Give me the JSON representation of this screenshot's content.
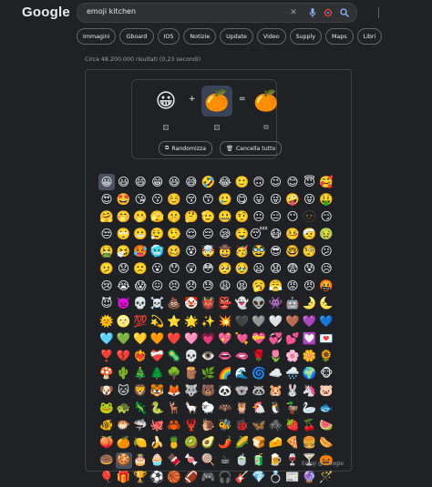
{
  "header": {
    "logo": "Google",
    "query": "emoji kitchen"
  },
  "icons": {
    "clear": "close-icon",
    "mic": "mic-icon",
    "lens": "lens-icon",
    "search": "search-icon"
  },
  "chips": [
    "Immagini",
    "Gboard",
    "IOS",
    "Notizie",
    "Update",
    "Video",
    "Supply",
    "Maps",
    "Libri"
  ],
  "stats": "Circa 48.200.000 risultati (0,23 secondi)",
  "kitchen": {
    "left_emoji": "😀",
    "right_emoji": "🍊",
    "result_emoji": "🍊",
    "plus": "+",
    "equals": "=",
    "shuffle_label": "Randomizza",
    "clear_label": "Cancella tutto",
    "credit": "Emoji @ Google"
  },
  "emoji_grid": [
    "😀",
    "😃",
    "😄",
    "😁",
    "😆",
    "😅",
    "🤣",
    "😂",
    "🙂",
    "🙃",
    "😉",
    "😊",
    "😇",
    "🥰",
    "😍",
    "🤩",
    "😘",
    "😗",
    "☺️",
    "😚",
    "😙",
    "🥲",
    "😋",
    "😛",
    "😜",
    "🤪",
    "😝",
    "🤑",
    "🤗",
    "🤭",
    "🫢",
    "🫣",
    "🤫",
    "🤔",
    "🫡",
    "🤐",
    "🤨",
    "😐",
    "😑",
    "😶",
    "🫥",
    "😏",
    "😒",
    "🙄",
    "😬",
    "😮‍💨",
    "🤥",
    "😌",
    "😔",
    "😪",
    "🤤",
    "😴",
    "😷",
    "🤒",
    "🤕",
    "🤢",
    "🤮",
    "🤧",
    "🥵",
    "🥶",
    "🥴",
    "😵",
    "🤯",
    "🤠",
    "🥳",
    "🥸",
    "😎",
    "🤓",
    "🧐",
    "😕",
    "🫤",
    "😟",
    "🙁",
    "😮",
    "😯",
    "😲",
    "😳",
    "🥺",
    "🥹",
    "😦",
    "😧",
    "😨",
    "😰",
    "😥",
    "😢",
    "😭",
    "😱",
    "😖",
    "😣",
    "😞",
    "😓",
    "😩",
    "😫",
    "🥱",
    "😤",
    "😡",
    "😠",
    "🤬",
    "😈",
    "👿",
    "💀",
    "☠️",
    "💩",
    "🤡",
    "👹",
    "👺",
    "👻",
    "👽",
    "👾",
    "🤖",
    "🌛",
    "🌜",
    "🌞",
    "🌝",
    "💯",
    "💫",
    "⭐",
    "🌟",
    "✨",
    "💥",
    "🖤",
    "🩶",
    "🤍",
    "🤎",
    "💜",
    "💙",
    "🩵",
    "💚",
    "💛",
    "🧡",
    "❤️",
    "🩷",
    "💗",
    "💖",
    "💘",
    "💝",
    "💞",
    "💕",
    "💟",
    "💌",
    "❣️",
    "💔",
    "❤️‍🔥",
    "❤️‍🩹",
    "🦠",
    "💀",
    "👁️",
    "👄",
    "🫦",
    "🌹",
    "🌷",
    "🌸",
    "🌼",
    "🌻",
    "🍄",
    "🌵",
    "🎄",
    "🌲",
    "🌳",
    "🪵",
    "🌿",
    "🌈",
    "🌊",
    "🌀",
    "☁️",
    "🌧️",
    "🌍",
    "🐵",
    "🐶",
    "🐱",
    "🦁",
    "🐯",
    "🦊",
    "🐺",
    "🐻",
    "🐼",
    "🐨",
    "🦝",
    "🐹",
    "🐰",
    "🦄",
    "🐷",
    "🐸",
    "🐢",
    "🦎",
    "🐍",
    "🦌",
    "🦙",
    "🐑",
    "🦇",
    "🦉",
    "🐔",
    "🐧",
    "🦆",
    "🦢",
    "🐟",
    "🐠",
    "🐡",
    "🦈",
    "🐙",
    "🦀",
    "🦞",
    "🐌",
    "🐝",
    "🐞",
    "🦋",
    "🕷️",
    "🍓",
    "🍒",
    "🍉",
    "🍑",
    "🍊",
    "🍋",
    "🍌",
    "🍍",
    "🥝",
    "🥑",
    "🌶️",
    "🌽",
    "🍞",
    "🧀",
    "🍕",
    "🍔",
    "🌭",
    "🍩",
    "🍪",
    "🎂",
    "🧁",
    "🍫",
    "🍬",
    "🍭",
    "☕",
    "🍵",
    "🧃",
    "🍺",
    "🍷",
    "🍸",
    "🎃",
    "🎈",
    "🎁",
    "🏆",
    "⚽",
    "🏀",
    "🏈",
    "🎮",
    "🎧",
    "🎸",
    "💎",
    "💍",
    "📰",
    "🔮",
    "🪄"
  ],
  "selected_index": 0,
  "selected_result_index": 225
}
